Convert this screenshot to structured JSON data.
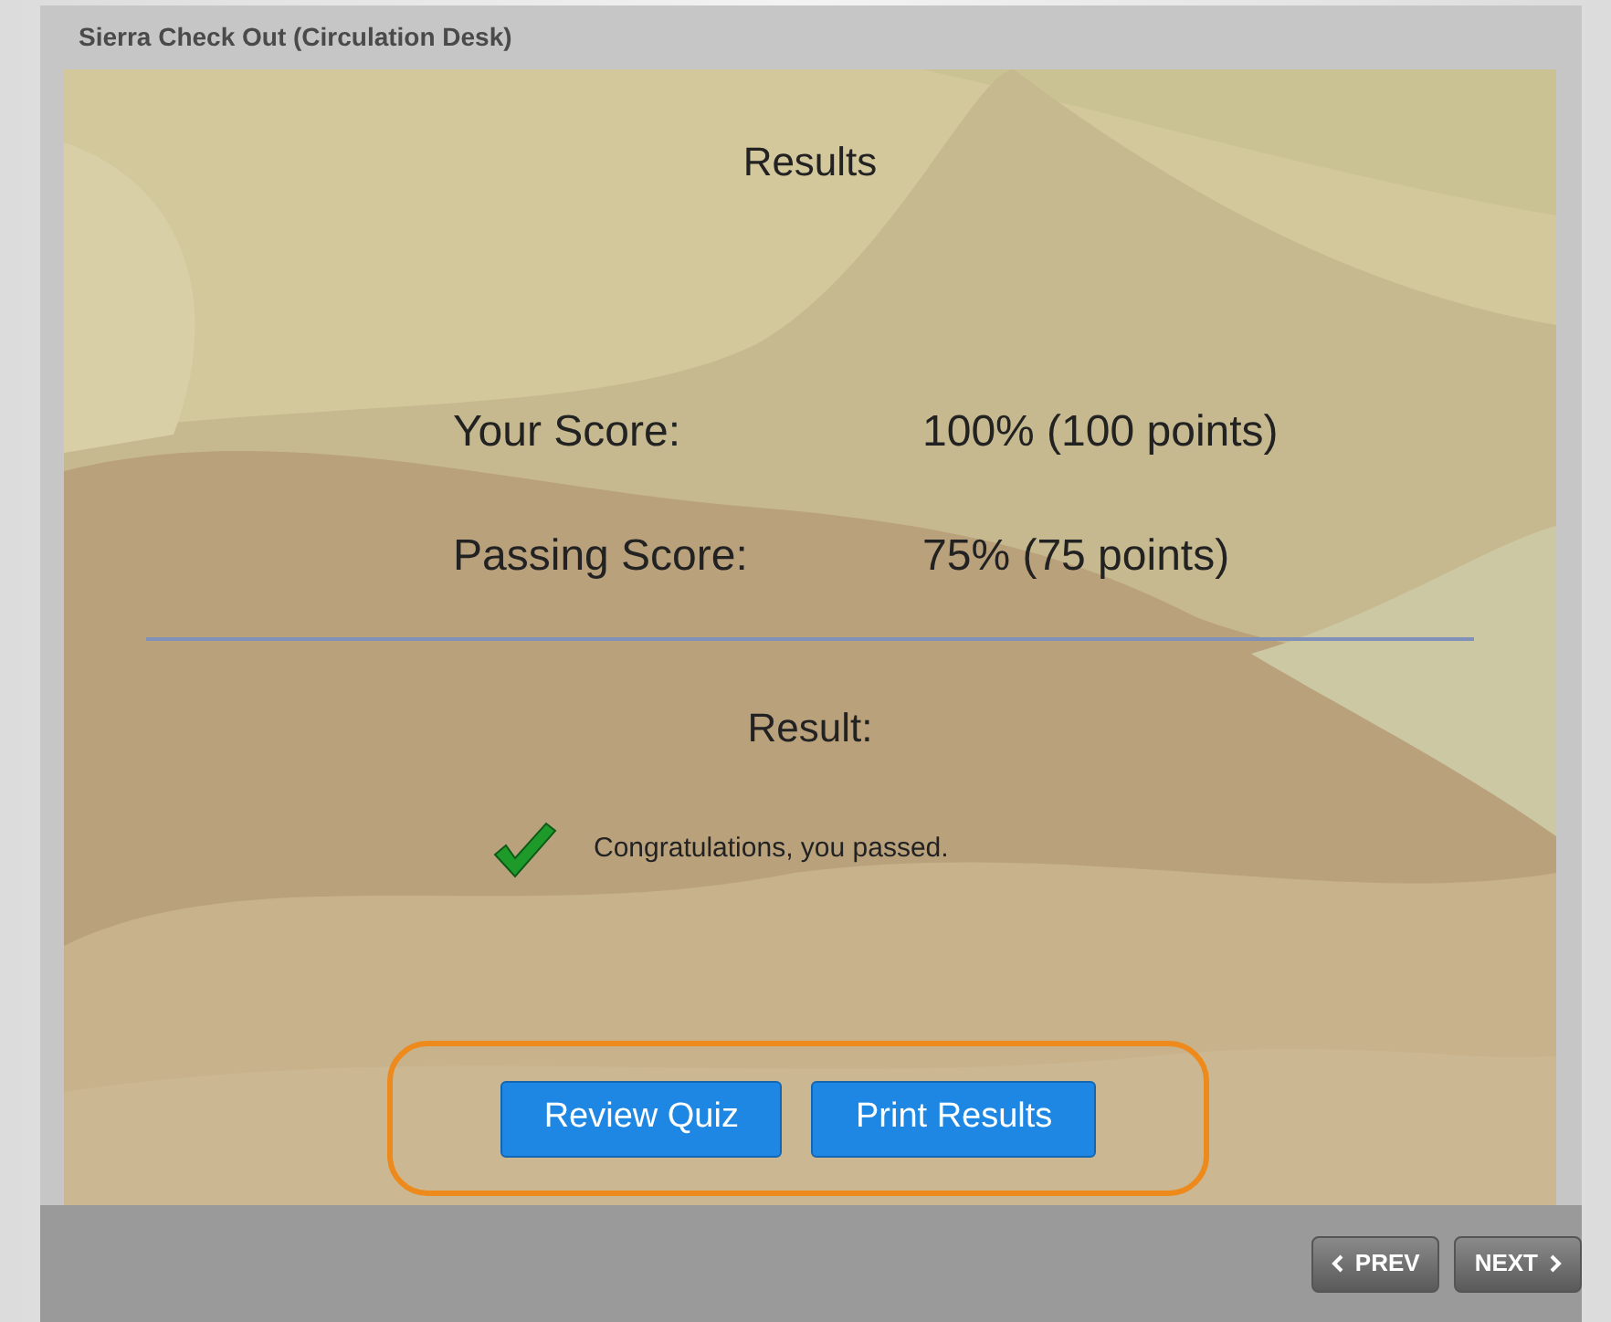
{
  "window": {
    "title": "Sierra Check Out (Circulation Desk)"
  },
  "slide": {
    "heading": "Results",
    "scores": [
      {
        "label": "Your Score:",
        "value": "100% (100 points)"
      },
      {
        "label": "Passing Score:",
        "value": "75% (75 points)"
      }
    ],
    "result": {
      "heading": "Result:",
      "message": "Congratulations, you passed."
    },
    "buttons": [
      {
        "label": "Review Quiz"
      },
      {
        "label": "Print Results"
      }
    ]
  },
  "nav": [
    {
      "kind": "prev",
      "label": "PREV"
    },
    {
      "kind": "next",
      "label": "NEXT"
    }
  ]
}
